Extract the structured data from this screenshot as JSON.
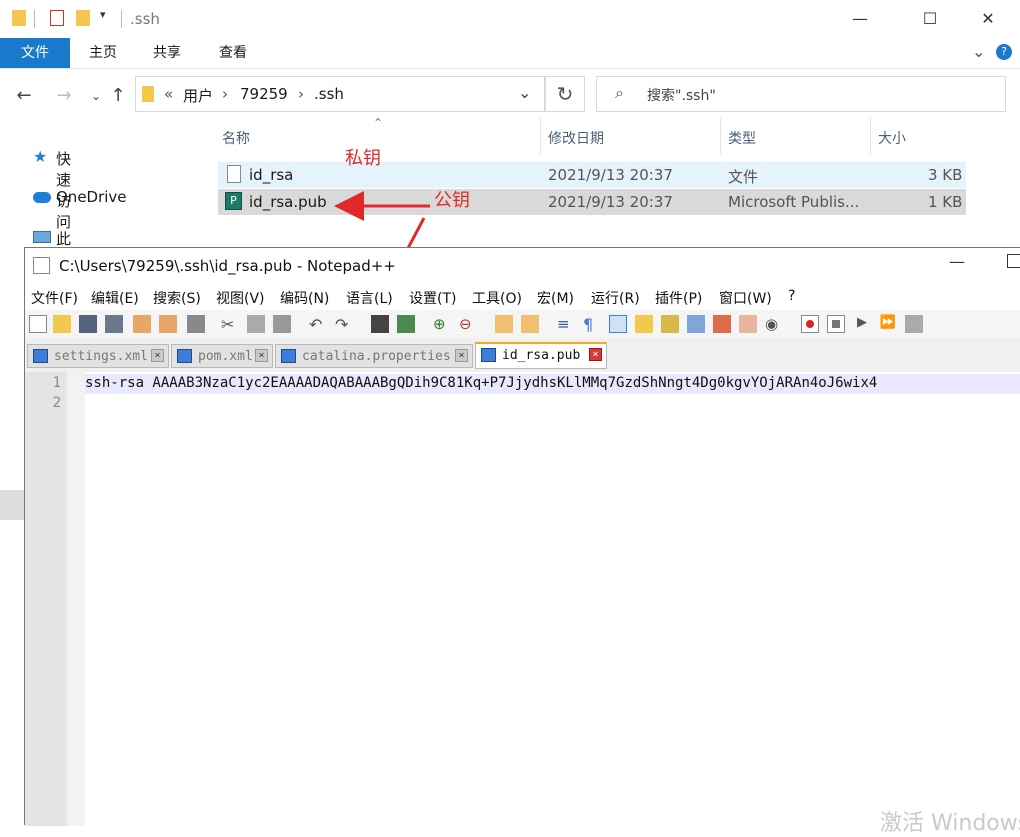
{
  "explorer": {
    "title": ".ssh",
    "ribbon_tabs": [
      "文件",
      "主页",
      "共享",
      "查看"
    ],
    "breadcrumb": {
      "prefix": "«",
      "parts": [
        "用户",
        "79259",
        ".ssh"
      ]
    },
    "search_placeholder": "搜索\".ssh\"",
    "sidebar": [
      {
        "label": "快速访问",
        "icon": "star-icon"
      },
      {
        "label": "OneDrive",
        "icon": "cloud-icon"
      },
      {
        "label": "此电脑",
        "icon": "computer-icon"
      }
    ],
    "columns": [
      "名称",
      "修改日期",
      "类型",
      "大小"
    ],
    "files": [
      {
        "name": "id_rsa",
        "date": "2021/9/13 20:37",
        "type": "文件",
        "size": "3 KB",
        "icon": "file-icon"
      },
      {
        "name": "id_rsa.pub",
        "date": "2021/9/13 20:37",
        "type": "Microsoft Publis...",
        "size": "1 KB",
        "icon": "publisher-file-icon"
      }
    ],
    "annotations": {
      "private_key": "私钥",
      "public_key": "公钥"
    },
    "colors": {
      "file_tab": "#1979ca",
      "annotation": "#e02a2a"
    }
  },
  "notepad": {
    "title": "C:\\Users\\79259\\.ssh\\id_rsa.pub - Notepad++",
    "menu": [
      "文件(F)",
      "编辑(E)",
      "搜索(S)",
      "视图(V)",
      "编码(N)",
      "语言(L)",
      "设置(T)",
      "工具(O)",
      "宏(M)",
      "运行(R)",
      "插件(P)",
      "窗口(W)",
      "?"
    ],
    "tabs": [
      {
        "label": "settings.xml",
        "active": false
      },
      {
        "label": "pom.xml",
        "active": false
      },
      {
        "label": "catalina.properties",
        "active": false
      },
      {
        "label": "id_rsa.pub",
        "active": true
      }
    ],
    "lines": [
      {
        "number": "1",
        "text": "ssh-rsa AAAAB3NzaC1yc2EAAAADAQABAAABgQDih9C81Kq+P7JjydhsKLlMMq7GzdShNngt4Dg0kgvYOjARAn4oJ6wix4"
      },
      {
        "number": "2",
        "text": ""
      }
    ]
  },
  "watermark": "激活 Windows"
}
